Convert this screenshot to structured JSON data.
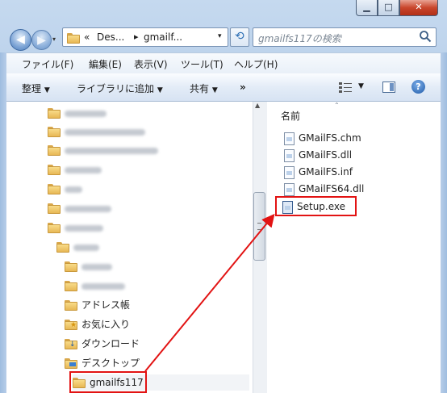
{
  "window": {
    "minimize_glyph": "▁",
    "maximize_glyph": "□",
    "close_glyph": "✕"
  },
  "nav": {
    "back_glyph": "◀",
    "forward_glyph": "▶",
    "breadcrumb": {
      "prefix": "«",
      "parts": [
        "Des...",
        "gmailf..."
      ],
      "separator": "▸"
    },
    "refresh_glyph": "⟲",
    "search_placeholder": "gmailfs117の検索"
  },
  "menu": [
    "ファイル(F)",
    "編集(E)",
    "表示(V)",
    "ツール(T)",
    "ヘルプ(H)"
  ],
  "commands": {
    "organize": "整理",
    "add_to_library": "ライブラリに追加",
    "share": "共有",
    "more": "»"
  },
  "tree": {
    "visible_items": [
      {
        "label": "アドレス帳",
        "icon": "contacts-folder-icon"
      },
      {
        "label": "お気に入り",
        "icon": "favorites-folder-icon"
      },
      {
        "label": "ダウンロード",
        "icon": "downloads-folder-icon"
      },
      {
        "label": "デスクトップ",
        "icon": "desktop-folder-icon"
      },
      {
        "label": "gmailfs117",
        "icon": "folder-icon"
      }
    ]
  },
  "filelist": {
    "column_header": "名前",
    "files": [
      {
        "name": "GMailFS.chm",
        "icon": "help-file-icon"
      },
      {
        "name": "GMailFS.dll",
        "icon": "dll-file-icon"
      },
      {
        "name": "GMailFS.inf",
        "icon": "inf-file-icon"
      },
      {
        "name": "GMailFS64.dll",
        "icon": "dll-file-icon"
      },
      {
        "name": "Setup.exe",
        "icon": "installer-icon"
      }
    ]
  },
  "colors": {
    "highlight_red": "#e21313",
    "window_blue": "#a9c4e4"
  }
}
